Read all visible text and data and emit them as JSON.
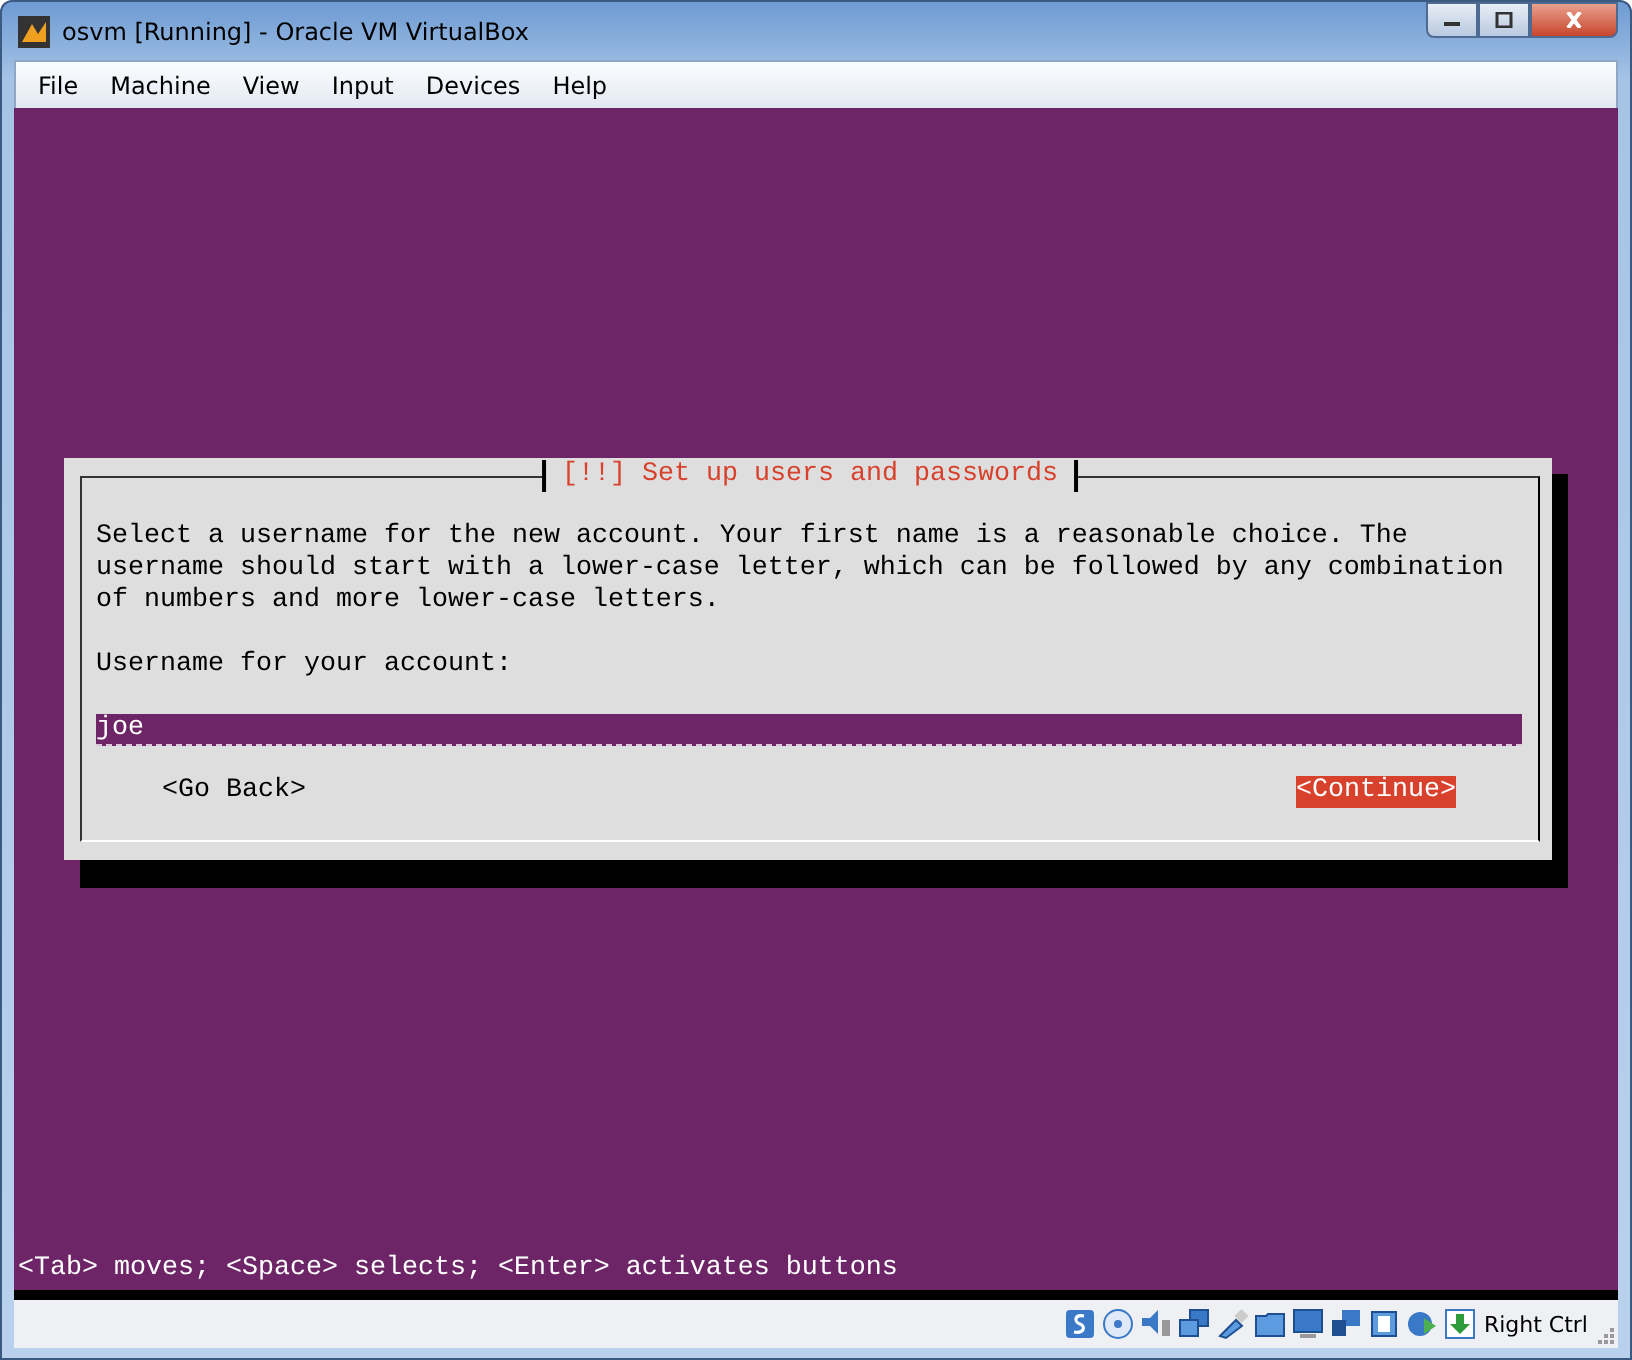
{
  "window": {
    "title": "osvm [Running] - Oracle VM VirtualBox"
  },
  "menu": [
    "File",
    "Machine",
    "View",
    "Input",
    "Devices",
    "Help"
  ],
  "dialog": {
    "title": "[!!] Set up users and passwords",
    "message": "Select a username for the new account. Your first name is a reasonable choice. The\nusername should start with a lower-case letter, which can be followed by any combination\nof numbers and more lower-case letters.",
    "field_label": "Username for your account:",
    "field": {
      "value": "joe"
    },
    "buttons": [
      {
        "label": "<Go Back>",
        "selected": false
      },
      {
        "label": "<Continue>",
        "selected": true
      }
    ]
  },
  "hint": "<Tab> moves; <Space> selects; <Enter> activates buttons",
  "status_bar": {
    "host_key": "Right Ctrl"
  }
}
